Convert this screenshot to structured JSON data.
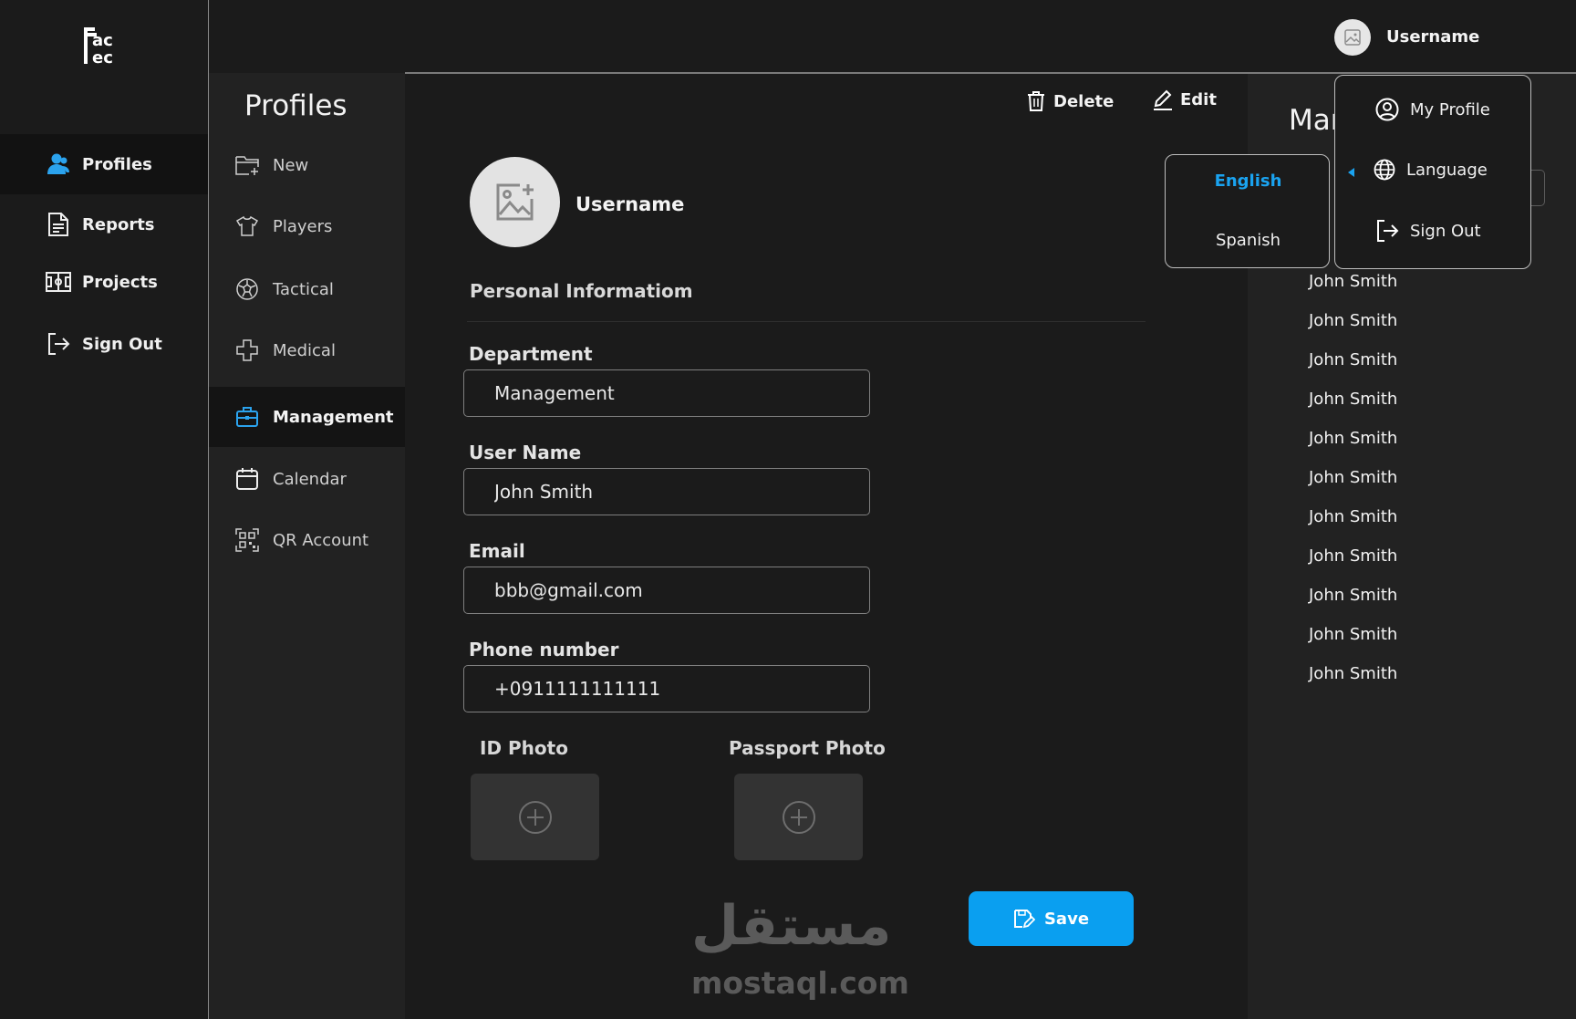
{
  "app": {
    "logo_text": "ac ec"
  },
  "left_nav": {
    "items": [
      {
        "label": "Profiles",
        "icon": "user-icon",
        "active": true
      },
      {
        "label": "Reports",
        "icon": "document-icon",
        "active": false
      },
      {
        "label": "Projects",
        "icon": "field-icon",
        "active": false
      },
      {
        "label": "Sign Out",
        "icon": "sign-out-icon",
        "active": false
      }
    ]
  },
  "header": {
    "username": "Username"
  },
  "sub_nav": {
    "title": "Profiles",
    "items": [
      {
        "label": "New",
        "icon": "new-folder-icon",
        "active": false
      },
      {
        "label": "Players",
        "icon": "shirt-icon",
        "active": false
      },
      {
        "label": "Tactical",
        "icon": "ball-icon",
        "active": false
      },
      {
        "label": "Medical",
        "icon": "medical-cross-icon",
        "active": false
      },
      {
        "label": "Management",
        "icon": "briefcase-icon",
        "active": true
      },
      {
        "label": "Calendar",
        "icon": "calendar-icon",
        "active": false
      },
      {
        "label": "QR Account",
        "icon": "qr-icon",
        "active": false
      }
    ]
  },
  "toolbar": {
    "delete_label": "Delete",
    "edit_label": "Edit"
  },
  "profile": {
    "username": "Username",
    "section_title": "Personal Informatiom"
  },
  "form": {
    "department": {
      "label": "Department",
      "value": "Management"
    },
    "user_name": {
      "label": "User Name",
      "value": "John Smith"
    },
    "email": {
      "label": "Email",
      "value": "bbb@gmail.com"
    },
    "phone": {
      "label": "Phone number",
      "value": "+0911111111111"
    },
    "id_photo_label": "ID Photo",
    "passport_photo_label": "Passport Photo",
    "save_label": "Save"
  },
  "watermark": {
    "arabic": "مستقل",
    "latin": "mostaql.com"
  },
  "right_panel": {
    "title": "Mar",
    "items": [
      "John Smith",
      "John Smith",
      "John Smith",
      "John Smith",
      "John Smith",
      "John Smith",
      "John Smith",
      "John Smith",
      "John Smith",
      "John Smith",
      "John Smith"
    ]
  },
  "language_menu": {
    "options": [
      {
        "label": "English",
        "selected": true
      },
      {
        "label": "Spanish",
        "selected": false
      }
    ]
  },
  "profile_menu": {
    "items": [
      {
        "label": "My Profile",
        "icon": "user-circle-icon"
      },
      {
        "label": "Language",
        "icon": "globe-icon"
      },
      {
        "label": "Sign Out",
        "icon": "sign-out-icon"
      }
    ]
  },
  "colors": {
    "accent": "#0a9ff0",
    "background": "#1b1b1b",
    "panel": "#222222"
  }
}
